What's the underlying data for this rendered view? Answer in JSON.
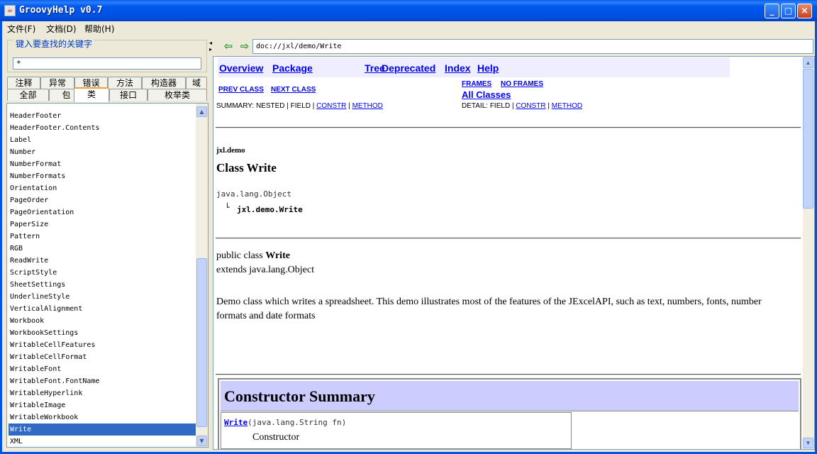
{
  "window": {
    "title": "GroovyHelp v0.7",
    "buttons": {
      "minimize": "_",
      "maximize": "□",
      "close": "×"
    }
  },
  "menu": [
    {
      "label": "文件(F)"
    },
    {
      "label": "文档(D)"
    },
    {
      "label": "帮助(H)"
    }
  ],
  "search": {
    "legend": "键入要查找的关键字",
    "value": "*"
  },
  "tabs_row1": [
    {
      "label": "注释"
    },
    {
      "label": "异常"
    },
    {
      "label": "错误"
    },
    {
      "label": "方法"
    },
    {
      "label": "构造器"
    },
    {
      "label": "域"
    }
  ],
  "tabs_row2": [
    {
      "label": "全部"
    },
    {
      "label": "包"
    },
    {
      "label": "类",
      "selected": true
    },
    {
      "label": "接口"
    },
    {
      "label": "枚举类"
    }
  ],
  "class_list": {
    "items": [
      "HeaderFooter",
      "HeaderFooter.Contents",
      "Label",
      "Number",
      "NumberFormat",
      "NumberFormats",
      "Orientation",
      "PageOrder",
      "PageOrientation",
      "PaperSize",
      "Pattern",
      "RGB",
      "ReadWrite",
      "ScriptStyle",
      "SheetSettings",
      "UnderlineStyle",
      "VerticalAlignment",
      "Workbook",
      "WorkbookSettings",
      "WritableCellFeatures",
      "WritableCellFormat",
      "WritableFont",
      "WritableFont.FontName",
      "WritableHyperlink",
      "WritableImage",
      "WritableWorkbook",
      "Write",
      "XML"
    ],
    "selected": "Write"
  },
  "address": {
    "back_icon": "back-arrow-icon",
    "forward_icon": "forward-arrow-icon",
    "url": "doc://jxl/demo/Write"
  },
  "doc": {
    "nav": {
      "overview": "Overview",
      "package": "Package",
      "tree": "Tree",
      "deprecated": "Deprecated",
      "index": "Index",
      "help": "Help"
    },
    "prev_class": "PREV CLASS",
    "next_class": "NEXT CLASS",
    "frames": "FRAMES",
    "no_frames": "NO FRAMES",
    "all_classes": "All Classes",
    "summary": {
      "prefix": "SUMMARY: NESTED | FIELD |",
      "constr": "CONSTR",
      "sep": "|",
      "method": "METHOD"
    },
    "detail": {
      "prefix": "DETAIL: FIELD |",
      "constr": "CONSTR",
      "sep": "|",
      "method": "METHOD"
    },
    "package_name": "jxl.demo",
    "class_title": "Class Write",
    "hierarchy": {
      "parent": "java.lang.Object",
      "branch": "└",
      "child": "jxl.demo.Write"
    },
    "declaration": {
      "prefix": "public class",
      "name": "Write",
      "extends": "extends java.lang.Object"
    },
    "description": "Demo class which writes a spreadsheet. This demo illustrates most of the features of the JExcelAPI, such as text, numbers, fonts, number formats and date formats",
    "constructor_summary": {
      "title": "Constructor Summary",
      "ctor_name": "Write",
      "ctor_params": "(java.lang.String  fn)",
      "ctor_desc": "Constructor"
    }
  },
  "colors": {
    "titlebar": "#0054e3",
    "selection": "#316ac5",
    "link": "#0000ee",
    "navbar_bg": "#eeeeff",
    "table_head_bg": "#ccccff"
  }
}
